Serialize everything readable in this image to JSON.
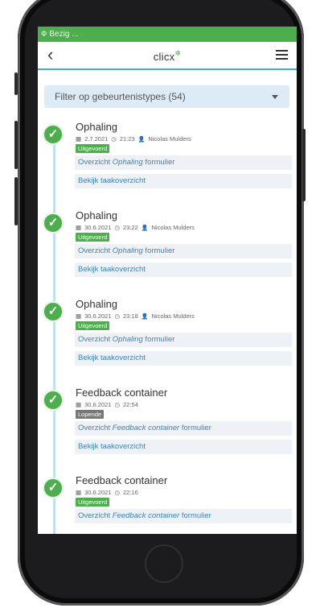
{
  "status": {
    "text": "Ф Bezig ..."
  },
  "header": {
    "back_icon": "chevron-left-icon",
    "logo_text": "clicx",
    "logo_mark": "✲",
    "menu_icon": "hamburger-icon"
  },
  "filter": {
    "label": "Filter op gebeurtenistypes (54)"
  },
  "events": [
    {
      "title": "Ophaling",
      "date": "2.7.2021",
      "time": "21:23",
      "user": "Nicolas Mulders",
      "badge": "Uitgevoerd",
      "badge_color": "#4cae4c",
      "form_prefix": "Overzicht ",
      "form_name": "Ophaling",
      "form_suffix": " formulier",
      "task_link": "Bekijk taakoverzicht"
    },
    {
      "title": "Ophaling",
      "date": "30.6.2021",
      "time": "23:22",
      "user": "Nicolas Mulders",
      "badge": "Uitgevoerd",
      "badge_color": "#4cae4c",
      "form_prefix": "Overzicht ",
      "form_name": "Ophaling",
      "form_suffix": " formulier",
      "task_link": "Bekijk taakoverzicht"
    },
    {
      "title": "Ophaling",
      "date": "30.6.2021",
      "time": "23:18",
      "user": "Nicolas Mulders",
      "badge": "Uitgevoerd",
      "badge_color": "#4cae4c",
      "form_prefix": "Overzicht ",
      "form_name": "Ophaling",
      "form_suffix": " formulier",
      "task_link": "Bekijk taakoverzicht"
    },
    {
      "title": "Feedback container",
      "date": "30.6.2021",
      "time": "22:54",
      "user": "",
      "badge": "Lopende",
      "badge_color": "#777777",
      "form_prefix": "Overzicht ",
      "form_name": "Feedback container",
      "form_suffix": " formulier",
      "task_link": "Bekijk taakoverzicht"
    },
    {
      "title": "Feedback container",
      "date": "30.6.2021",
      "time": "22:16",
      "user": "",
      "badge": "Uitgevoerd",
      "badge_color": "#4cae4c",
      "form_prefix": "Overzicht ",
      "form_name": "Feedback container",
      "form_suffix": " formulier",
      "task_link": ""
    }
  ]
}
